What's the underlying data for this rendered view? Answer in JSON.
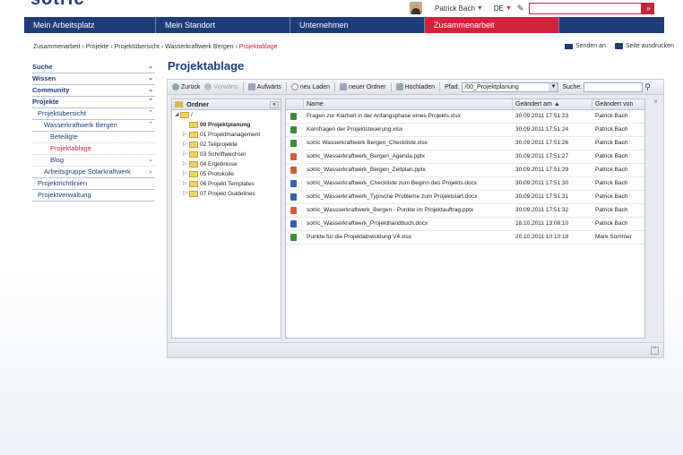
{
  "header": {
    "logo_text": "sotric",
    "user_name": "Patrick Bach",
    "language": "DE",
    "search_value": ""
  },
  "nav": [
    {
      "label": "Mein Arbeitsplatz"
    },
    {
      "label": "Mein Standort"
    },
    {
      "label": "Unternehmen"
    },
    {
      "label": "Zusammenarbeit"
    }
  ],
  "breadcrumb": {
    "items": [
      "Zusammenarbeit",
      "Projekte",
      "Projektübersicht",
      "Wasserkraftwerk Bergen"
    ],
    "current": "Projektablage"
  },
  "actions": {
    "send": "Senden an",
    "print": "Seite ausdrucken"
  },
  "sidebar": {
    "items": [
      {
        "label": "Suche"
      },
      {
        "label": "Wissen"
      },
      {
        "label": "Community"
      },
      {
        "label": "Projekte"
      },
      {
        "label": "Projektübersicht"
      },
      {
        "label": "Wasserkraftwerk Bergen"
      },
      {
        "label": "Beteiligte"
      },
      {
        "label": "Projektablage"
      },
      {
        "label": "Blog"
      },
      {
        "label": "Arbeitsgruppe Solarkraftwerk"
      },
      {
        "label": "Projektrichtlinien"
      },
      {
        "label": "Projektverwaltung"
      }
    ]
  },
  "page": {
    "title": "Projektablage"
  },
  "toolbar": {
    "back": "Zurück",
    "forward": "Vorwärts",
    "up": "Aufwärts",
    "reload": "neu Laden",
    "new_folder": "neuer Ordner",
    "upload": "Hochladen",
    "path_label": "Pfad:",
    "path_value": "/00_Projektplanung",
    "search_label": "Suche:",
    "search_value": ""
  },
  "tree": {
    "header": "Ordner",
    "root": "/",
    "folders": [
      {
        "label": "00 Projektplanung"
      },
      {
        "label": "01 Projektmanagement"
      },
      {
        "label": "02 Teilprojekte"
      },
      {
        "label": "03 Schriftwechsel"
      },
      {
        "label": "04 Ergebnisse"
      },
      {
        "label": "05 Protokolle"
      },
      {
        "label": "06 Projekt Templates"
      },
      {
        "label": "07 Projekt Guidelines"
      }
    ]
  },
  "grid": {
    "columns": {
      "name": "Name",
      "changed_at": "Geändert am",
      "changed_by": "Geändert von"
    },
    "rows": [
      {
        "type": "xlsx",
        "name": "Fragen zur Klarheit in der Anfangsphase eines Projekts.xlsx",
        "date": "30.09.2011 17:51:23",
        "by": "Patrick Bach"
      },
      {
        "type": "xlsx",
        "name": "Kernfragen der Projektsteuerung.xlsx",
        "date": "30.09.2011 17:51:24",
        "by": "Patrick Bach"
      },
      {
        "type": "xlsx",
        "name": "sotric Wasserkraftwerk Bergen_Checkliste.xlsx",
        "date": "30.09.2011 17:51:26",
        "by": "Patrick Bach"
      },
      {
        "type": "pptx",
        "name": "sotric_Wasserkraftwerk_Bergen_Agenda.pptx",
        "date": "30.09.2011 17:51:27",
        "by": "Patrick Bach"
      },
      {
        "type": "pptx",
        "name": "sotric_Wasserkraftwerk_Bergen_Zeitplan.pptx",
        "date": "30.09.2011 17:51:29",
        "by": "Patrick Bach"
      },
      {
        "type": "docx",
        "name": "sotric_Wasserkraftwerk_Checkliste zum Beginn des Projekts.docx",
        "date": "30.09.2011 17:51:30",
        "by": "Patrick Bach"
      },
      {
        "type": "docx",
        "name": "sotric_Wasserkraftwerk_Typische Probleme zum Projektstart.docx",
        "date": "30.09.2011 17:51:31",
        "by": "Patrick Bach"
      },
      {
        "type": "pptx",
        "name": "sotric_Wassserkraftwerk_Bergen - Punkte im Projektauftrag.pptx",
        "date": "30.09.2011 17:51:32",
        "by": "Patrick Bach"
      },
      {
        "type": "docx",
        "name": "sotric_Wasserkraftwerk_Projekthandbuch.docx",
        "date": "18.10.2011 13:08:10",
        "by": "Patrick Bach"
      },
      {
        "type": "xlsx",
        "name": "Punkte für die Projektabwicklung V4.xlsx",
        "date": "20.10.2011 10:10:18",
        "by": "Mark Sommer"
      }
    ]
  }
}
